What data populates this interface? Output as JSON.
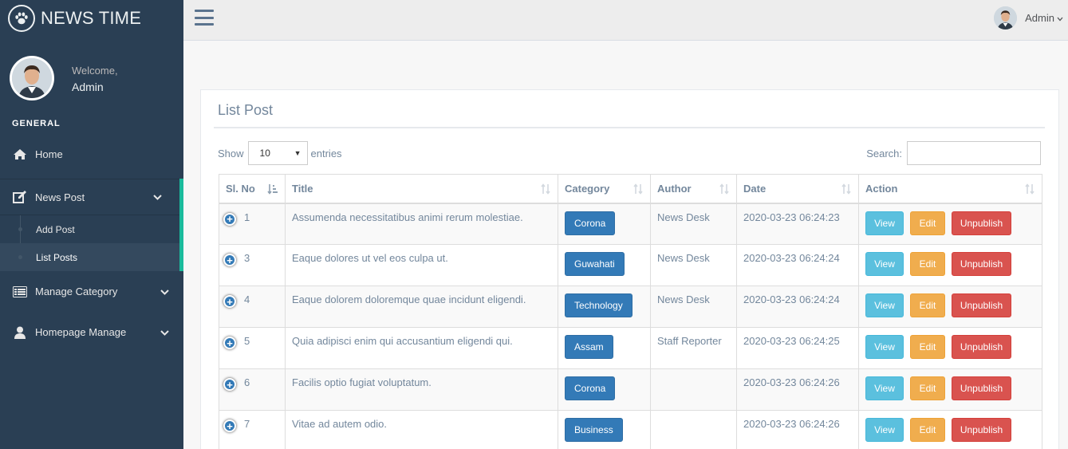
{
  "brand": {
    "title": "NEWS TIME",
    "icon": "paw-icon"
  },
  "profile": {
    "welcome": "Welcome,",
    "name": "Admin"
  },
  "sidebar": {
    "section": "GENERAL",
    "items": [
      {
        "label": "Home",
        "icon": "home-icon"
      },
      {
        "label": "News Post",
        "icon": "edit-icon"
      },
      {
        "label": "Manage Category",
        "icon": "list-icon"
      },
      {
        "label": "Homepage Manage",
        "icon": "user-icon"
      }
    ],
    "sub_items": [
      {
        "label": "Add Post"
      },
      {
        "label": "List Posts"
      }
    ]
  },
  "topnav": {
    "user": "Admin"
  },
  "panel": {
    "title": "List Post",
    "show_label": "Show",
    "entries_label": "entries",
    "page_length": "10",
    "search_label": "Search:",
    "search_value": ""
  },
  "table": {
    "headers": [
      "Sl. No",
      "Title",
      "Category",
      "Author",
      "Date",
      "Action"
    ],
    "rows": [
      {
        "sl": "1",
        "title": "Assumenda necessitatibus animi rerum molestiae.",
        "category": "Corona",
        "author": "News Desk",
        "date": "2020-03-23 06:24:23"
      },
      {
        "sl": "3",
        "title": "Eaque dolores ut vel eos culpa ut.",
        "category": "Guwahati",
        "author": "News Desk",
        "date": "2020-03-23 06:24:24"
      },
      {
        "sl": "4",
        "title": "Eaque dolorem doloremque quae incidunt eligendi.",
        "category": "Technology",
        "author": "News Desk",
        "date": "2020-03-23 06:24:24"
      },
      {
        "sl": "5",
        "title": "Quia adipisci enim qui accusantium eligendi qui.",
        "category": "Assam",
        "author": "Staff Reporter",
        "date": "2020-03-23 06:24:25"
      },
      {
        "sl": "6",
        "title": "Facilis optio fugiat voluptatum.",
        "category": "Corona",
        "author": "",
        "date": "2020-03-23 06:24:26"
      },
      {
        "sl": "7",
        "title": "Vitae ad autem odio.",
        "category": "Business",
        "author": "",
        "date": "2020-03-23 06:24:26"
      }
    ],
    "actions": {
      "view": "View",
      "edit": "Edit",
      "unpublish": "Unpublish"
    }
  },
  "colors": {
    "sidebar": "#2a3f54",
    "accent": "#1abb9c",
    "primary": "#337ab7",
    "info": "#5bc0de",
    "warning": "#f0ad4e",
    "danger": "#d9534f"
  }
}
